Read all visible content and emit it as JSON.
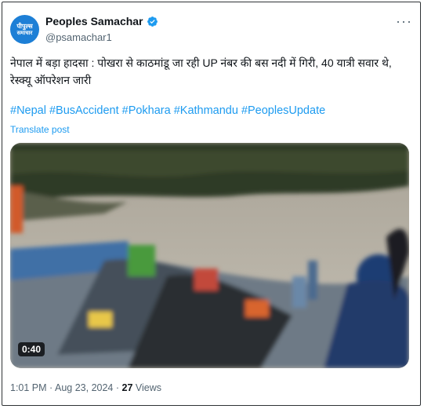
{
  "author": {
    "name": "Peoples Samachar",
    "handle": "@psamachar1",
    "avatar_line1": "पीपुल्स",
    "avatar_line2": "समाचार"
  },
  "tweet": {
    "text": "नेपाल में बड़ा हादसा : पोखरा से काठमांडू जा रही UP नंबर की बस नदी में गिरी, 40 यात्री सवार थे, रेस्क्यू ऑपरेशन जारी",
    "hashtags": [
      "#Nepal",
      "#BusAccident",
      "#Pokhara",
      "#Kathmandu",
      "#PeoplesUpdate"
    ],
    "translate_label": "Translate post"
  },
  "media": {
    "duration": "0:40"
  },
  "meta": {
    "time": "1:01 PM",
    "separator": "·",
    "date": "Aug 23, 2024",
    "views_count": "27",
    "views_label": "Views"
  },
  "icons": {
    "verified": "verified-badge-icon",
    "more": "more-options-icon"
  },
  "colors": {
    "link": "#1d9bf0",
    "secondary_text": "#536471",
    "verified": "#1d9bf0",
    "avatar_bg": "#1d7fd6"
  }
}
